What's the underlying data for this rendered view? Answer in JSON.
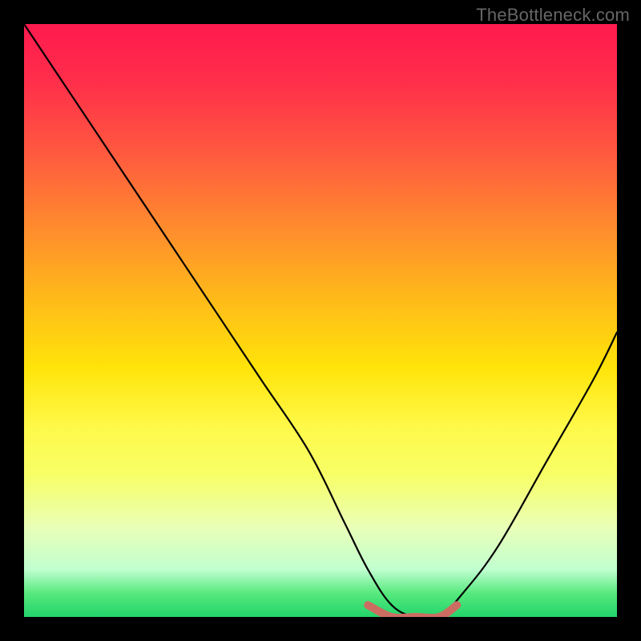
{
  "watermark": "TheBottleneck.com",
  "chart_data": {
    "type": "line",
    "title": "",
    "xlabel": "",
    "ylabel": "",
    "xlim": [
      0,
      100
    ],
    "ylim": [
      0,
      100
    ],
    "grid": false,
    "legend": false,
    "background": "red-yellow-green vertical gradient (red top, green bottom)",
    "series": [
      {
        "name": "bottleneck-curve",
        "color": "#000000",
        "x": [
          0,
          8,
          16,
          24,
          32,
          40,
          48,
          54,
          58,
          62,
          66,
          70,
          74,
          80,
          88,
          96,
          100
        ],
        "values": [
          100,
          88,
          76,
          64,
          52,
          40,
          28,
          16,
          8,
          2,
          0,
          0,
          4,
          12,
          26,
          40,
          48
        ]
      }
    ],
    "marker": {
      "name": "optimal-range",
      "color": "#cc6d62",
      "x": [
        58,
        62,
        66,
        70,
        73
      ],
      "values": [
        2,
        0,
        0,
        0,
        2
      ]
    }
  }
}
